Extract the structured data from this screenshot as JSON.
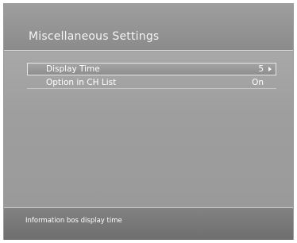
{
  "header": {
    "title": "Miscellaneous Settings"
  },
  "menu": {
    "items": [
      {
        "label": "Display Time",
        "value": "5",
        "selected": true,
        "icon": "arrow-right-icon"
      },
      {
        "label": "Option in CH List",
        "value": "On",
        "selected": false
      }
    ]
  },
  "footer": {
    "help_text": "Information bos display time"
  },
  "colors": {
    "background": "#9c9c9c",
    "footer": "#767676",
    "text": "#ffffff",
    "divider": "#c6c6c6"
  }
}
